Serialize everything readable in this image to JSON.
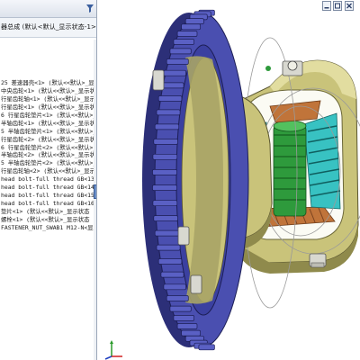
{
  "tree": {
    "assembly_name": "器总成 (默认<默认_显示状态-1>)",
    "items": [
      "25  差速器壳<1> (默认<<默认>_显示",
      "中央齿轮<1> (默认<<默认>_显示状态",
      "行星齿轮轴<1> (默认<<默认>_显示状",
      "行星齿轮<1> (默认<<默认>_显示状态",
      "6  行星齿轮垫片<1> (默认<<默认>_显示状",
      "半轴齿轮<1> (默认<<默认>_显示状态",
      "5  半轴齿轮垫片<1> (默认<<默认>_显示状",
      "行星齿轮<2> (默认<<默认>_显示状态",
      "6  行星齿轮垫片<2> (默认<<默认>_显示状",
      "半轴齿轮<2> (默认<<默认>_显示状态",
      "5  半轴齿轮垫片<2> (默认<<默认>_显示状",
      "行星齿轮轴<2> (默认<<默认>_显示状",
      "head bolt-full thread GB<13> (GB_FA",
      "head bolt-full thread GB<14> (GB_FA",
      "head bolt-full thread GB<15> (GB_FA",
      "head bolt-full thread GB<16> (GB_FA",
      "垫片<1> (默认<<默认>_显示状态 1>)",
      "螺栓<1> (默认<<默认>_显示状态 1>",
      "FASTENER_NUT_SWAB1 M12-N<显示状态-57"
    ]
  },
  "icons": {
    "tree_filter": "funnel-icon",
    "minimize": "minimize-icon",
    "restore": "restore-icon",
    "close": "close-icon",
    "triad": "axis-triad-icon"
  },
  "colors": {
    "ring_gear": "#4a4fb0",
    "ring_gear_dark": "#2c2f78",
    "housing": "#c9c37a",
    "housing_shadow": "#8f8a4c",
    "pinion_cyan": "#38c2c2",
    "pinion_green": "#2e9a3c",
    "side_gear": "#c0743a",
    "cover_gray": "#d8d8d0"
  }
}
